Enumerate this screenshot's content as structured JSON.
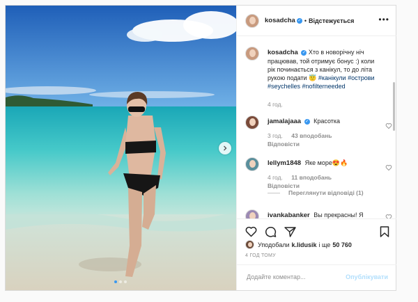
{
  "header": {
    "username": "kosadcha",
    "separator": "•",
    "follow_label": "Відстежується",
    "more_label": "•••"
  },
  "caption": {
    "username": "kosadcha",
    "text": "Хто в новорічну ніч працював, той отримує бонус :) коли рік починається з канікул, то до літа рукою подати",
    "emoji": "😇",
    "hashtags": [
      "#канікули",
      "#острови",
      "#seychelles",
      "#nofilterneeded"
    ],
    "time": "4 год."
  },
  "comments": [
    {
      "username": "jamalajaaa",
      "text": "Красотка",
      "time": "3 год.",
      "likes": "43 вподобань",
      "reply": "Відповісти"
    },
    {
      "username": "lellym1848",
      "text": "Яке море😍🔥",
      "time": "4 год.",
      "likes": "11 вподобань",
      "reply": "Відповісти",
      "view_replies": "Переглянути відповіді (1)"
    },
    {
      "username": "ivankabanker",
      "text": "Вы прекрасны! Я"
    }
  ],
  "likes": {
    "prefix": "Уподобали",
    "user": "k.lidusik",
    "suffix": "і ще",
    "count": "50 760"
  },
  "timestamp": "4 ГОД ТОМУ",
  "add_comment": {
    "placeholder": "Додайте коментар...",
    "publish_label": "Опублікувати"
  },
  "carousel": {
    "total": 3,
    "active": 1
  },
  "colors": {
    "accent": "#3897f0",
    "publish_disabled": "#b2dffc",
    "hashtag": "#003569"
  }
}
